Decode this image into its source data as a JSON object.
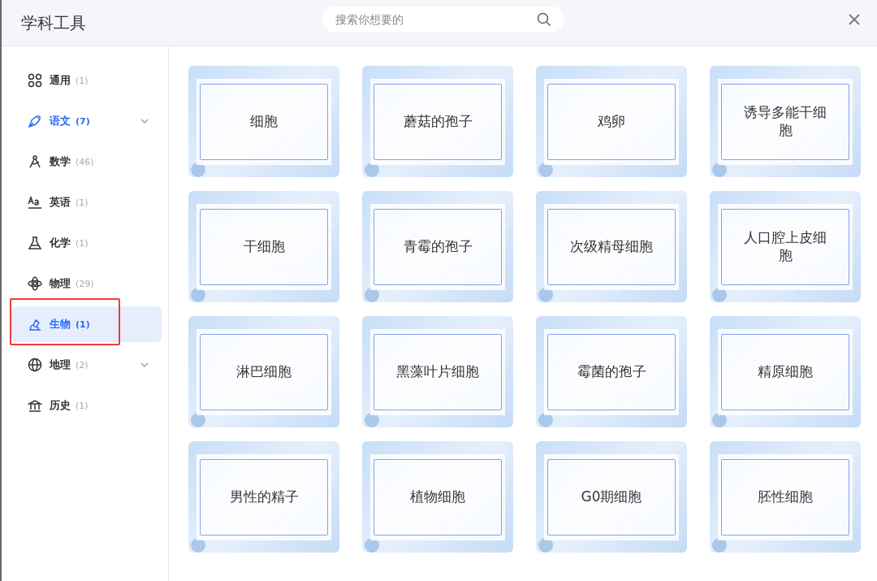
{
  "window": {
    "title": "学科工具"
  },
  "search": {
    "placeholder": "搜索你想要的"
  },
  "sidebar": {
    "items": [
      {
        "label": "通用",
        "count": "(1)",
        "selected": false,
        "hovered": false,
        "expandable": false,
        "outlined": false
      },
      {
        "label": "语文",
        "count": "(7)",
        "selected": false,
        "hovered": true,
        "expandable": true,
        "outlined": false
      },
      {
        "label": "数学",
        "count": "(46)",
        "selected": false,
        "hovered": false,
        "expandable": false,
        "outlined": false
      },
      {
        "label": "英语",
        "count": "(1)",
        "selected": false,
        "hovered": false,
        "expandable": false,
        "outlined": false
      },
      {
        "label": "化学",
        "count": "(1)",
        "selected": false,
        "hovered": false,
        "expandable": false,
        "outlined": false
      },
      {
        "label": "物理",
        "count": "(29)",
        "selected": false,
        "hovered": false,
        "expandable": false,
        "outlined": false
      },
      {
        "label": "生物",
        "count": "(1)",
        "selected": true,
        "hovered": false,
        "expandable": false,
        "outlined": true
      },
      {
        "label": "地理",
        "count": "(2)",
        "selected": false,
        "hovered": false,
        "expandable": true,
        "outlined": false
      },
      {
        "label": "历史",
        "count": "(1)",
        "selected": false,
        "hovered": false,
        "expandable": false,
        "outlined": false
      }
    ]
  },
  "cards": [
    "细胞",
    "蘑菇的孢子",
    "鸡卵",
    "诱导多能干细胞",
    "干细胞",
    "青霉的孢子",
    "次级精母细胞",
    "人口腔上皮细胞",
    "淋巴细胞",
    "黑藻叶片细胞",
    "霉菌的孢子",
    "精原细胞",
    "男性的精子",
    "植物细胞",
    "G0期细胞",
    "胚性细胞"
  ]
}
